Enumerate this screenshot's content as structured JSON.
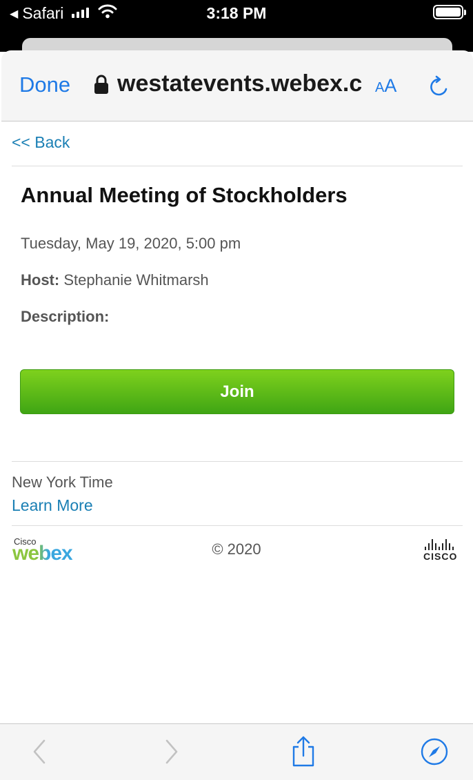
{
  "status_bar": {
    "back_app": "Safari",
    "time": "3:18 PM",
    "icons": [
      "back-triangle-icon",
      "signal-icon",
      "wifi-icon",
      "battery-icon"
    ]
  },
  "browser": {
    "done_label": "Done",
    "url": "westatevents.webex.com",
    "text_size_label_small": "A",
    "text_size_label_large": "A",
    "accent_color": "#1f7ae6"
  },
  "page": {
    "back_link": "<< Back",
    "title": "Annual Meeting of Stockholders",
    "datetime": "Tuesday, May 19, 2020, 5:00 pm",
    "host_label": "Host:",
    "host_name": "Stephanie Whitmarsh",
    "description_label": "Description:",
    "join_label": "Join",
    "join_color": "#4cae16",
    "timezone": "New York Time",
    "learn_more": "Learn More"
  },
  "footer": {
    "webex_logo_small": "Cisco",
    "webex_logo_word": "webex",
    "copyright": "© 2020",
    "cisco_logo_word": "CISCO"
  },
  "toolbar": {
    "icons": [
      "back-arrow-icon",
      "forward-arrow-icon",
      "share-icon",
      "compass-icon"
    ]
  }
}
